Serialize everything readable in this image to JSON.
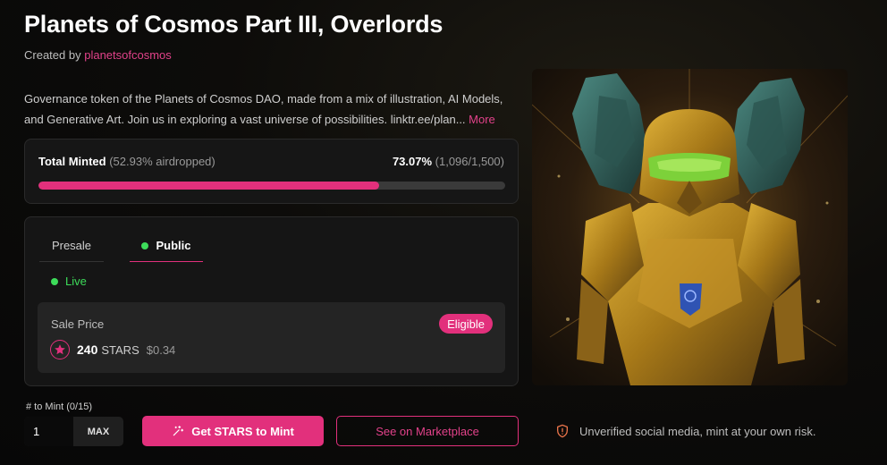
{
  "collection": {
    "title": "Planets of Cosmos Part III, Overlords",
    "created_by_prefix": "Created by",
    "creator": "planetsofcosmos",
    "description": "Governance token of the Planets of Cosmos DAO, made from a mix of illustration, AI Models, and Generative Art. Join us in exploring a vast universe of possibilities. linktr.ee/plan...",
    "more_label": "More"
  },
  "minted": {
    "label": "Total Minted",
    "airdropped": "(52.93% airdropped)",
    "percent": "73.07%",
    "count": "(1,096/1,500)",
    "progress": 0.7307
  },
  "phases": {
    "tabs": [
      {
        "label": "Presale",
        "active": false
      },
      {
        "label": "Public",
        "active": true
      }
    ],
    "status": "Live",
    "price_label": "Sale Price",
    "eligible_label": "Eligible",
    "price_amount": "240",
    "price_unit": "STARS",
    "price_usd": "$0.34"
  },
  "mint": {
    "label": "# to Mint (0/15)",
    "quantity": "1",
    "max_label": "MAX",
    "get_stars_label": "Get STARS to Mint",
    "marketplace_label": "See on Marketplace"
  },
  "warning": "Unverified social media, mint at your own risk.",
  "colors": {
    "accent": "#e2307c",
    "live": "#3ddc5a"
  },
  "icons": {
    "stars_coin": "star-icon",
    "mint_button": "sparkle-icon",
    "warning": "shield-alert-icon"
  }
}
